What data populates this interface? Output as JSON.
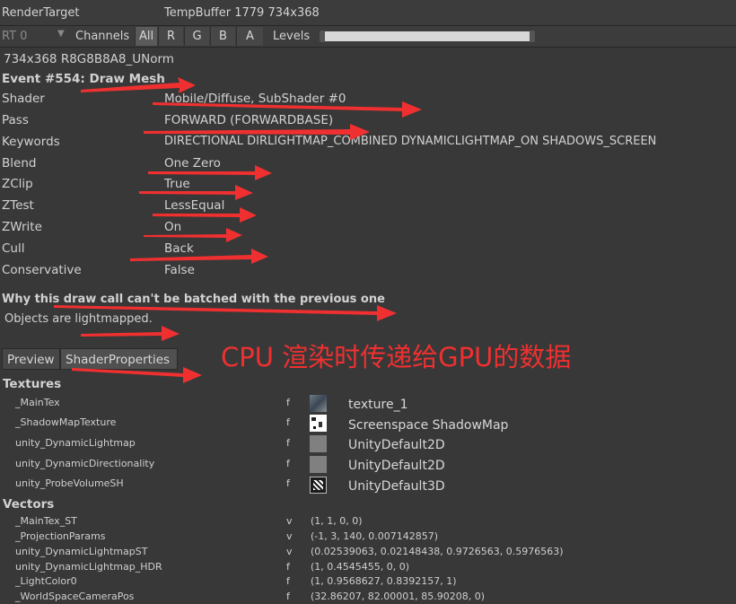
{
  "header": {
    "render_target_label": "RenderTarget",
    "render_target_value": "TempBuffer 1779 734x368"
  },
  "toolbar": {
    "rt_dropdown": "RT 0",
    "channels_label": "Channels",
    "channel_buttons": [
      "All",
      "R",
      "G",
      "B",
      "A"
    ],
    "levels_label": "Levels"
  },
  "format": "734x368 R8G8B8A8_UNorm",
  "event_title": "Event #554: Draw Mesh",
  "properties": [
    {
      "key": "Shader",
      "value": "Mobile/Diffuse, SubShader #0"
    },
    {
      "key": "Pass",
      "value": "FORWARD (FORWARDBASE)"
    },
    {
      "key": "Keywords",
      "value": "DIRECTIONAL DIRLIGHTMAP_COMBINED DYNAMICLIGHTMAP_ON SHADOWS_SCREEN"
    },
    {
      "key": "Blend",
      "value": "One Zero"
    },
    {
      "key": "ZClip",
      "value": "True"
    },
    {
      "key": "ZTest",
      "value": "LessEqual"
    },
    {
      "key": "ZWrite",
      "value": "On"
    },
    {
      "key": "Cull",
      "value": "Back"
    },
    {
      "key": "Conservative",
      "value": "False"
    }
  ],
  "batch_title": "Why this draw call can't be batched with the previous one",
  "batch_reason": "Objects are lightmapped.",
  "tabs": [
    "Preview",
    "ShaderProperties"
  ],
  "annotation": "CPU 渲染时传递给GPU的数据",
  "textures_title": "Textures",
  "textures": [
    {
      "name": "_MainTex",
      "type": "f",
      "value": "texture_1"
    },
    {
      "name": "_ShadowMapTexture",
      "type": "f",
      "value": "Screenspace ShadowMap"
    },
    {
      "name": "unity_DynamicLightmap",
      "type": "f",
      "value": "UnityDefault2D"
    },
    {
      "name": "unity_DynamicDirectionality",
      "type": "f",
      "value": "UnityDefault2D"
    },
    {
      "name": "unity_ProbeVolumeSH",
      "type": "f",
      "value": "UnityDefault3D"
    }
  ],
  "vectors_title": "Vectors",
  "vectors": [
    {
      "name": "_MainTex_ST",
      "type": "v",
      "value": "(1, 1, 0, 0)"
    },
    {
      "name": "_ProjectionParams",
      "type": "v",
      "value": "(-1, 3, 140, 0.007142857)"
    },
    {
      "name": "unity_DynamicLightmapST",
      "type": "v",
      "value": "(0.02539063, 0.02148438, 0.9726563, 0.5976563)"
    },
    {
      "name": "unity_DynamicLightmap_HDR",
      "type": "f",
      "value": "(1, 0.4545455, 0, 0)"
    },
    {
      "name": "_LightColor0",
      "type": "f",
      "value": "(1, 0.9568627, 0.8392157, 1)"
    },
    {
      "name": "_WorldSpaceCameraPos",
      "type": "f",
      "value": "(32.86207, 82.00001, 85.90208, 0)"
    }
  ],
  "colors": {
    "background": "#383838",
    "annotation_red": "#f03030"
  }
}
